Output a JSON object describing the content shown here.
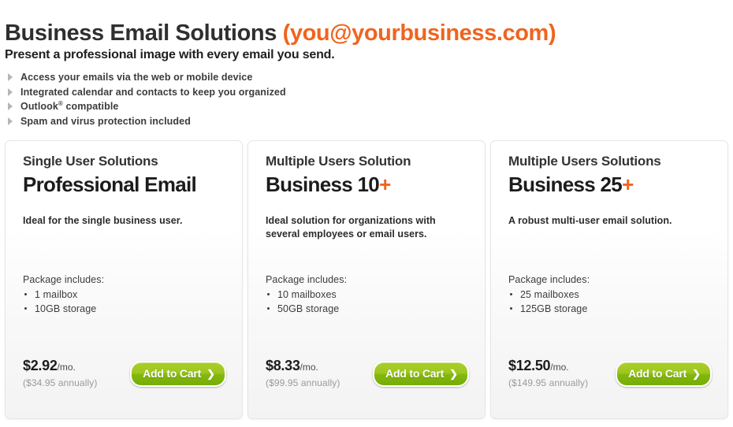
{
  "header": {
    "title_main": "Business Email Solutions",
    "title_email": "(you@yourbusiness.com)",
    "subtitle": "Present a professional image with every email you send.",
    "features": [
      "Access your emails via the web or mobile device",
      "Integrated calendar and contacts to keep you organized",
      "Spam and virus protection included"
    ],
    "feature_outlook_prefix": "Outlook",
    "feature_outlook_mark": "®",
    "feature_outlook_suffix": "compatible"
  },
  "colors": {
    "accent_orange": "#f0641e",
    "button_green_top": "#aace2a",
    "button_green_bottom": "#76ad05",
    "text_dark": "#1c1c1c",
    "text_muted": "#9a9a9a"
  },
  "common": {
    "package_title": "Package includes:",
    "cart_label": "Add to Cart",
    "cart_arrow": "❯",
    "per_month": "/mo."
  },
  "cards": [
    {
      "eyebrow": "Single User Solutions",
      "plan_name": "Professional Email",
      "plan_suffix": "",
      "description": "Ideal for the single business user.",
      "package_items": [
        "1 mailbox",
        "10GB storage"
      ],
      "price_monthly": "$2.92",
      "price_annual": "($34.95 annually)"
    },
    {
      "eyebrow": "Multiple Users Solution",
      "plan_name": "Business 10",
      "plan_suffix": "+",
      "description": "Ideal solution for organizations with several employees or email users.",
      "package_items": [
        "10 mailboxes",
        "50GB storage"
      ],
      "price_monthly": "$8.33",
      "price_annual": "($99.95 annually)"
    },
    {
      "eyebrow": "Multiple Users Solutions",
      "plan_name": "Business 25",
      "plan_suffix": "+",
      "description": "A robust multi-user email solution.",
      "package_items": [
        "25 mailboxes",
        "125GB storage"
      ],
      "price_monthly": "$12.50",
      "price_annual": "($149.95 annually)"
    }
  ]
}
